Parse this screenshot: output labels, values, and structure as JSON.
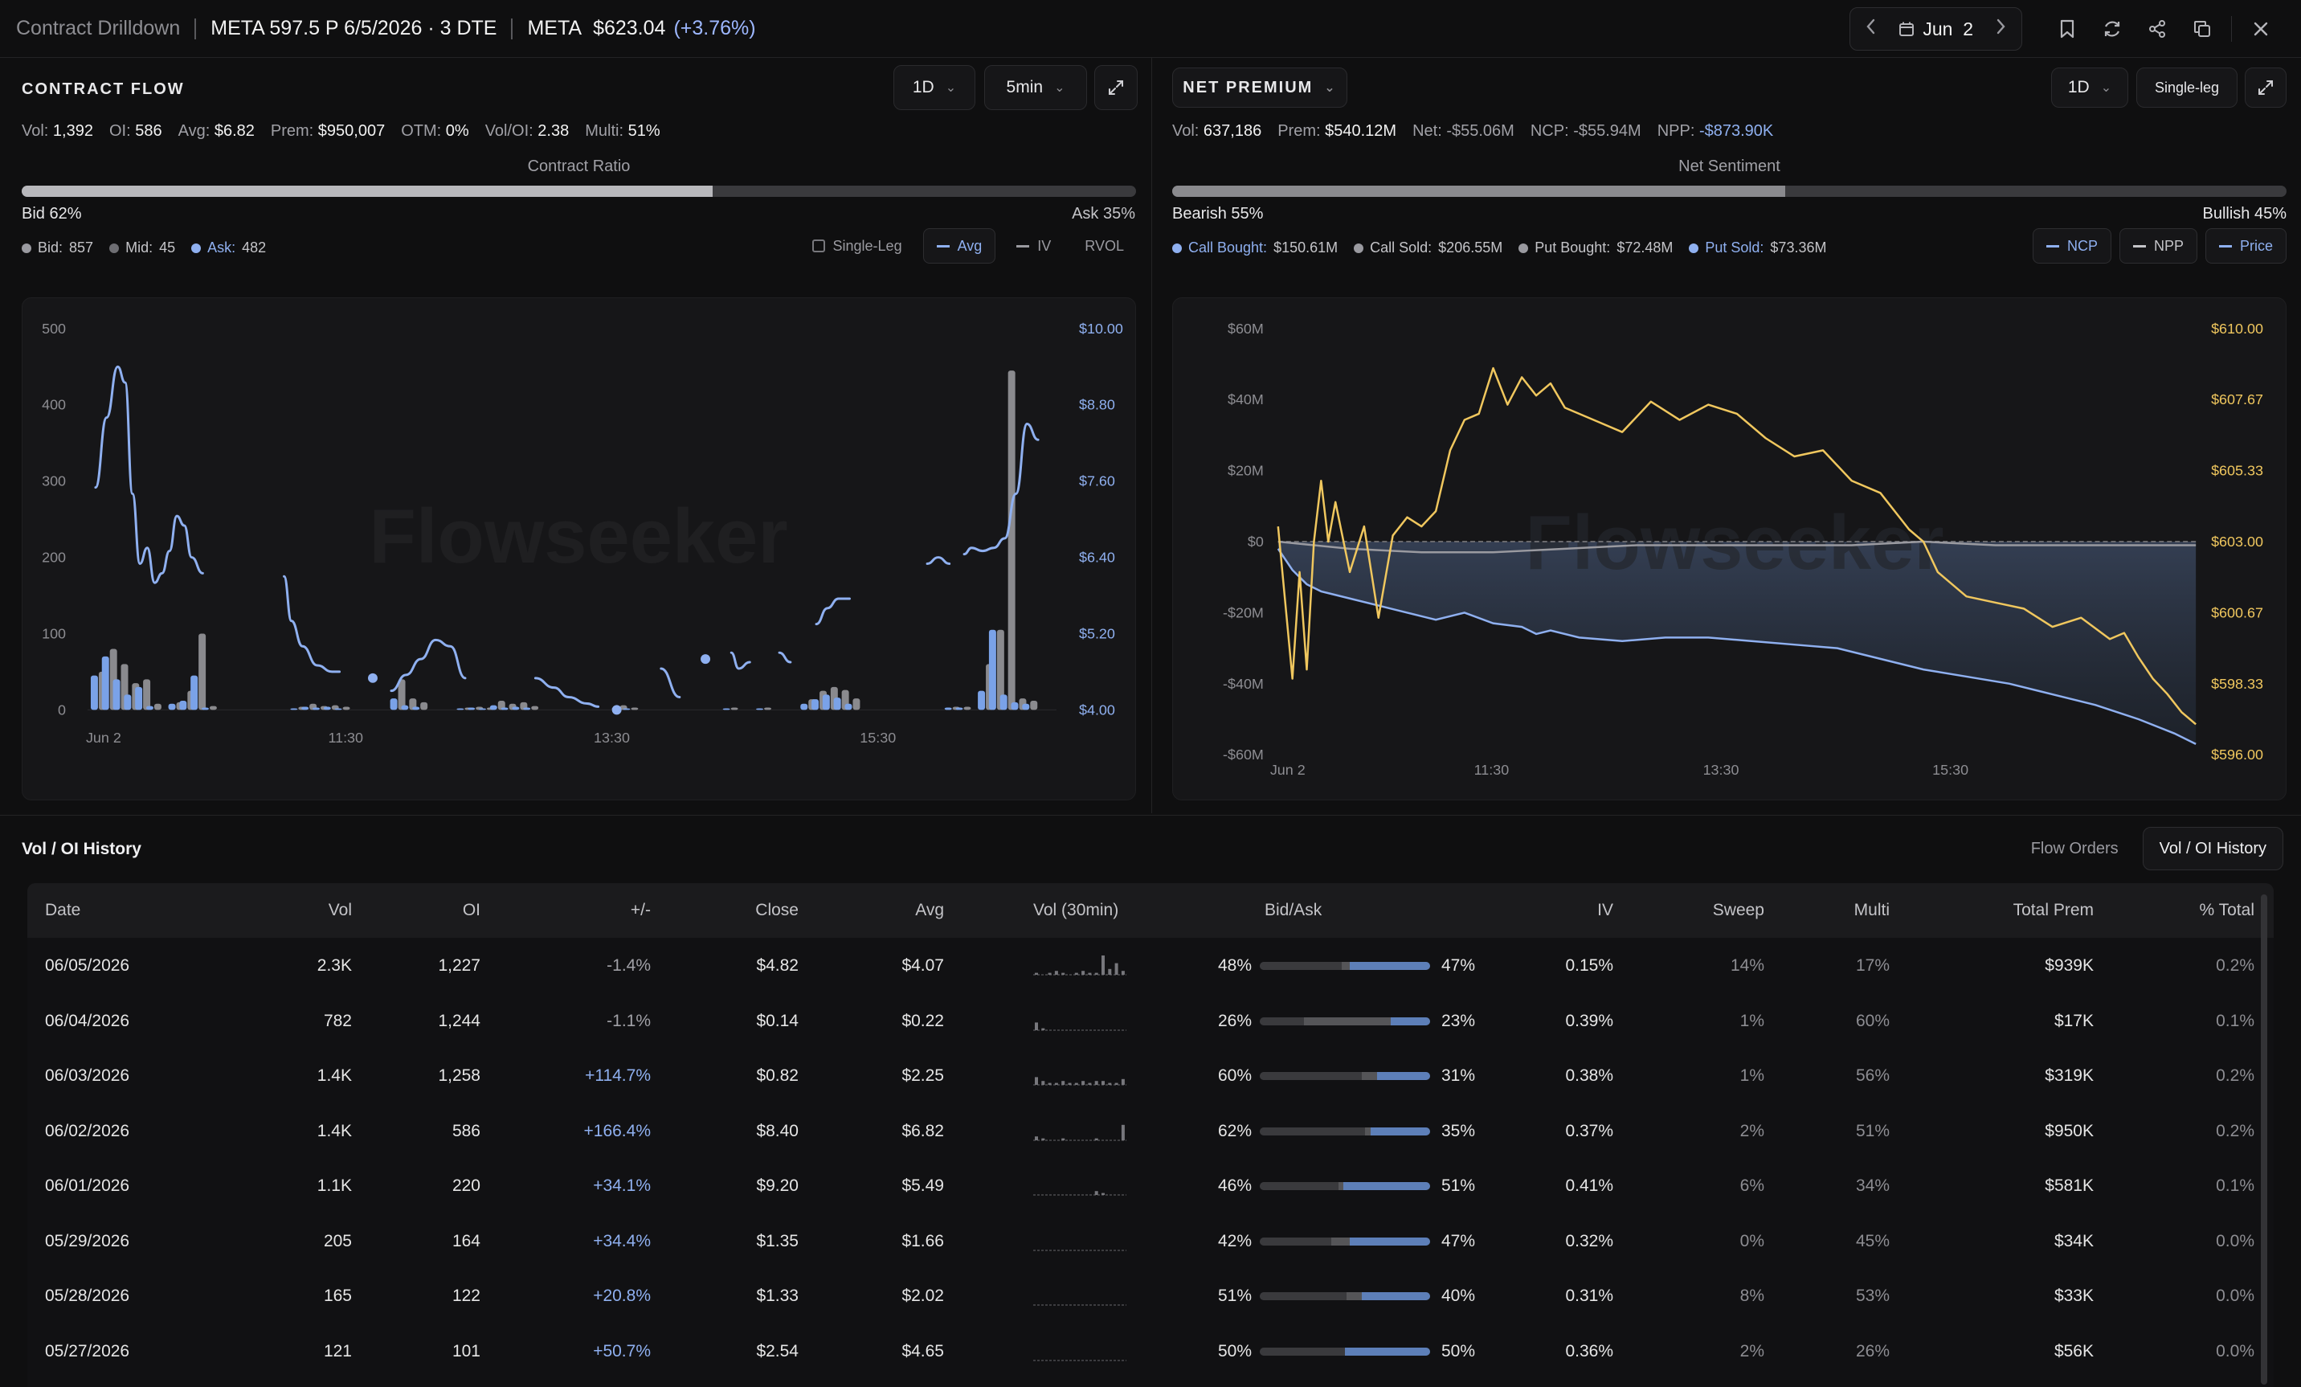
{
  "header": {
    "title": "Contract Drilldown",
    "contract": "META 597.5 P 6/5/2026 · 3 DTE",
    "ticker": "META",
    "price": "$623.04",
    "change": "(+3.76%)",
    "date": "Jun  2"
  },
  "flow": {
    "title": "CONTRACT FLOW",
    "range": "1D",
    "interval": "5min",
    "stats": [
      {
        "label": "Vol:",
        "value": "1,392"
      },
      {
        "label": "OI:",
        "value": "586"
      },
      {
        "label": "Avg:",
        "value": "$6.82"
      },
      {
        "label": "Prem:",
        "value": "$950,007"
      },
      {
        "label": "OTM:",
        "value": "0%"
      },
      {
        "label": "Vol/OI:",
        "value": "2.38"
      },
      {
        "label": "Multi:",
        "value": "51%"
      }
    ],
    "ratio_label": "Contract Ratio",
    "bid_pct": 62,
    "bid_text": "Bid 62%",
    "ask_text": "Ask 35%",
    "legend": [
      {
        "label": "Bid:",
        "value": "857",
        "color": "#9a9aa0"
      },
      {
        "label": "Mid:",
        "value": "45",
        "color": "#6e6e73"
      },
      {
        "label": "Ask:",
        "value": "482",
        "color": "#8fb0f0"
      }
    ],
    "toggles": {
      "single_leg": "Single-Leg",
      "avg": "Avg",
      "iv": "IV",
      "rvol": "RVOL"
    }
  },
  "premium": {
    "title": "NET PREMIUM",
    "range": "1D",
    "mode": "Single-leg",
    "stats": [
      {
        "label": "Vol:",
        "value": "637,186"
      },
      {
        "label": "Prem:",
        "value": "$540.12M"
      },
      {
        "label": "Net:",
        "value": "-$55.06M"
      },
      {
        "label": "NCP:",
        "value": "-$55.94M"
      },
      {
        "label": "NPP:",
        "value": "-$873.90K"
      }
    ],
    "sentiment_label": "Net Sentiment",
    "bearish_pct": 55,
    "bearish_text": "Bearish 55%",
    "bullish_text": "Bullish 45%",
    "legend": [
      {
        "label": "Call Bought:",
        "value": "$150.61M",
        "color": "#8fb0f0"
      },
      {
        "label": "Call Sold:",
        "value": "$206.55M",
        "color": "#9a9aa0"
      },
      {
        "label": "Put Bought:",
        "value": "$72.48M",
        "color": "#9a9aa0"
      },
      {
        "label": "Put Sold:",
        "value": "$73.36M",
        "color": "#8fb0f0"
      }
    ],
    "toggles": {
      "ncp": "NCP",
      "npp": "NPP",
      "price": "Price"
    }
  },
  "chart_data": [
    {
      "type": "bar",
      "watermark": "Flowseeker",
      "x_ticks": [
        "Jun 2",
        "11:30",
        "13:30",
        "15:30"
      ],
      "y_left_ticks": [
        "500",
        "400",
        "300",
        "200",
        "100",
        "0"
      ],
      "y_right_ticks": [
        "$10.00",
        "$8.80",
        "$7.60",
        "$6.40",
        "$5.20",
        "$4.00"
      ],
      "ylim": [
        0,
        500
      ],
      "y2lim": [
        4.0,
        10.0
      ],
      "bars": [
        {
          "t": 0.0,
          "ask": 45,
          "bid": 50
        },
        {
          "t": 1.5,
          "ask": 70,
          "bid": 80
        },
        {
          "t": 3.0,
          "ask": 40,
          "bid": 60
        },
        {
          "t": 4.5,
          "ask": 20,
          "bid": 35
        },
        {
          "t": 6.0,
          "ask": 30,
          "bid": 40
        },
        {
          "t": 7.5,
          "ask": 5,
          "bid": 8
        },
        {
          "t": 10.5,
          "ask": 8,
          "bid": 10
        },
        {
          "t": 12.0,
          "ask": 12,
          "bid": 25
        },
        {
          "t": 13.5,
          "ask": 45,
          "bid": 100
        },
        {
          "t": 15.0,
          "ask": 3,
          "bid": 5
        },
        {
          "t": 27.0,
          "ask": 2,
          "bid": 4
        },
        {
          "t": 28.5,
          "ask": 4,
          "bid": 8
        },
        {
          "t": 30.0,
          "ask": 3,
          "bid": 5
        },
        {
          "t": 31.5,
          "ask": 4,
          "bid": 6
        },
        {
          "t": 33.0,
          "ask": 2,
          "bid": 4
        },
        {
          "t": 40.5,
          "ask": 15,
          "bid": 40
        },
        {
          "t": 42.0,
          "ask": 6,
          "bid": 15
        },
        {
          "t": 43.5,
          "ask": 4,
          "bid": 10
        },
        {
          "t": 49.5,
          "ask": 2,
          "bid": 3
        },
        {
          "t": 51.0,
          "ask": 3,
          "bid": 4
        },
        {
          "t": 52.5,
          "ask": 2,
          "bid": 3
        },
        {
          "t": 54.0,
          "ask": 6,
          "bid": 12
        },
        {
          "t": 55.5,
          "ask": 3,
          "bid": 8
        },
        {
          "t": 57.0,
          "ask": 4,
          "bid": 10
        },
        {
          "t": 58.5,
          "ask": 3,
          "bid": 5
        },
        {
          "t": 70.5,
          "ask": 3,
          "bid": 6
        },
        {
          "t": 72.0,
          "ask": 2,
          "bid": 3
        },
        {
          "t": 85.5,
          "ask": 2,
          "bid": 3
        },
        {
          "t": 90.0,
          "ask": 2,
          "bid": 3
        },
        {
          "t": 96.0,
          "ask": 8,
          "bid": 14
        },
        {
          "t": 97.5,
          "ask": 14,
          "bid": 25
        },
        {
          "t": 99.0,
          "ask": 20,
          "bid": 30
        },
        {
          "t": 100.5,
          "ask": 16,
          "bid": 26
        },
        {
          "t": 102.0,
          "ask": 8,
          "bid": 15
        },
        {
          "t": 115.5,
          "ask": 3,
          "bid": 4
        },
        {
          "t": 117.0,
          "ask": 3,
          "bid": 4
        },
        {
          "t": 120.0,
          "ask": 25,
          "bid": 60
        },
        {
          "t": 121.5,
          "ask": 105,
          "bid": 105
        },
        {
          "t": 123.0,
          "ask": 20,
          "bid": 445
        },
        {
          "t": 124.5,
          "ask": 10,
          "bid": 15
        },
        {
          "t": 126.0,
          "ask": 8,
          "bid": 12
        }
      ],
      "avg_segments": [
        [
          [
            0,
            7.5
          ],
          [
            1.5,
            8.6
          ],
          [
            3.0,
            9.4
          ],
          [
            4.0,
            9.15
          ],
          [
            5.0,
            7.4
          ],
          [
            6.0,
            6.3
          ],
          [
            7.0,
            6.55
          ],
          [
            8.0,
            6.0
          ],
          [
            9.0,
            6.15
          ],
          [
            10.0,
            6.5
          ],
          [
            11.0,
            7.05
          ],
          [
            12.0,
            6.9
          ],
          [
            13.0,
            6.4
          ],
          [
            14.5,
            6.15
          ]
        ],
        [
          [
            25.5,
            6.1
          ],
          [
            26.5,
            5.4
          ],
          [
            28.0,
            5.0
          ],
          [
            30.0,
            4.7
          ],
          [
            32.0,
            4.6
          ],
          [
            33.0,
            4.6
          ]
        ],
        [
          [
            37.5,
            4.5
          ]
        ],
        [
          [
            40.0,
            4.3
          ],
          [
            42.0,
            4.55
          ],
          [
            44.0,
            4.8
          ],
          [
            46.0,
            5.1
          ],
          [
            48.0,
            5.0
          ],
          [
            50.0,
            4.5
          ]
        ],
        [
          [
            59.5,
            4.5
          ],
          [
            62.0,
            4.35
          ],
          [
            64.0,
            4.2
          ],
          [
            66.5,
            4.1
          ],
          [
            68.0,
            4.05
          ]
        ],
        [
          [
            70.5,
            4.0
          ]
        ],
        [
          [
            76.5,
            4.65
          ],
          [
            79.0,
            4.2
          ]
        ],
        [
          [
            82.5,
            4.8
          ]
        ],
        [
          [
            86.0,
            4.9
          ],
          [
            87.0,
            4.65
          ],
          [
            88.5,
            4.75
          ]
        ],
        [
          [
            92.5,
            4.9
          ],
          [
            94.0,
            4.75
          ]
        ],
        [
          [
            97.5,
            5.35
          ],
          [
            99.0,
            5.6
          ],
          [
            100.5,
            5.75
          ],
          [
            102.0,
            5.75
          ]
        ],
        [
          [
            112.5,
            6.3
          ],
          [
            114.0,
            6.4
          ],
          [
            115.5,
            6.3
          ]
        ],
        [
          [
            117.5,
            6.45
          ],
          [
            118.5,
            6.55
          ],
          [
            120.0,
            6.5
          ],
          [
            121.5,
            6.55
          ],
          [
            123.0,
            6.7
          ],
          [
            124.5,
            7.4
          ],
          [
            126.0,
            8.5
          ],
          [
            127.5,
            8.25
          ]
        ]
      ]
    },
    {
      "type": "line",
      "watermark": "Flowseeker",
      "x_ticks": [
        "Jun 2",
        "11:30",
        "13:30",
        "15:30"
      ],
      "y_left_ticks": [
        "$60M",
        "$40M",
        "$20M",
        "$0",
        "-$20M",
        "-$40M",
        "-$60M"
      ],
      "y_right_ticks": [
        "$610.00",
        "$607.67",
        "$605.33",
        "$603.00",
        "$600.67",
        "$598.33",
        "$596.00"
      ],
      "ylim": [
        -60,
        60
      ],
      "y2lim": [
        596.0,
        610.0
      ],
      "series": [
        {
          "name": "NCP",
          "color": "#8fb0f0",
          "x": [
            0,
            2,
            4,
            6,
            10,
            14,
            18,
            22,
            26,
            30,
            34,
            36,
            38,
            42,
            48,
            54,
            60,
            66,
            72,
            78,
            84,
            90,
            96,
            102,
            108,
            114,
            120,
            125,
            128
          ],
          "y": [
            -2,
            -8,
            -12,
            -14,
            -16,
            -18,
            -20,
            -22,
            -20,
            -23,
            -24,
            -26,
            -25,
            -27,
            -28,
            -27,
            -27,
            -28,
            -29,
            -30,
            -33,
            -36,
            -38,
            -40,
            -43,
            -46,
            -50,
            -54,
            -57
          ]
        },
        {
          "name": "NPP",
          "color": "#9a9aa0",
          "x": [
            0,
            10,
            20,
            30,
            40,
            50,
            60,
            70,
            80,
            90,
            100,
            110,
            120,
            128
          ],
          "y": [
            0,
            -2,
            -3,
            -3,
            -2,
            -1,
            -1,
            -1,
            -1,
            0,
            -1,
            -1,
            -1,
            -1
          ]
        },
        {
          "name": "Price",
          "color": "#f0c75e",
          "x": [
            0,
            1,
            2,
            3,
            4,
            5,
            6,
            7,
            8,
            10,
            12,
            14,
            16,
            18,
            20,
            22,
            24,
            26,
            28,
            30,
            32,
            34,
            36,
            38,
            40,
            44,
            48,
            52,
            56,
            60,
            64,
            68,
            72,
            76,
            80,
            84,
            86,
            88,
            90,
            92,
            96,
            100,
            104,
            108,
            112,
            116,
            118,
            120,
            122,
            124,
            126,
            128
          ],
          "y": [
            603.5,
            601.0,
            598.5,
            602.0,
            598.8,
            603.0,
            605.0,
            603.0,
            604.3,
            602.0,
            603.5,
            600.5,
            603.2,
            603.8,
            603.5,
            604.0,
            606.0,
            607.0,
            607.2,
            608.7,
            607.5,
            608.4,
            607.8,
            608.2,
            607.4,
            607.0,
            606.6,
            607.6,
            607.0,
            607.5,
            607.2,
            606.4,
            605.8,
            606.0,
            605.0,
            604.6,
            604.0,
            603.4,
            603.0,
            602.0,
            601.2,
            601.0,
            600.8,
            600.2,
            600.5,
            599.8,
            600.0,
            599.2,
            598.5,
            598.0,
            597.4,
            597.0
          ]
        }
      ]
    }
  ],
  "history": {
    "title": "Vol / OI History",
    "tabs": [
      "Flow Orders",
      "Vol / OI History"
    ],
    "columns": [
      "Date",
      "Vol",
      "OI",
      "+/-",
      "Close",
      "Avg",
      "Vol (30min)",
      "Bid/Ask",
      "IV",
      "Sweep",
      "Multi",
      "Total Prem",
      "% Total"
    ],
    "rows": [
      {
        "date": "06/05/2026",
        "vol": "2.3K",
        "oi": "1,227",
        "chg": "-1.4%",
        "close": "$4.82",
        "avg": "$4.07",
        "spark": [
          1,
          0,
          1,
          2,
          1,
          0,
          1,
          2,
          1,
          1,
          10,
          3,
          6,
          2
        ],
        "bid": "48%",
        "ask": "47%",
        "bidf": 0.48,
        "askf": 0.47,
        "iv": "0.15%",
        "sweep": "14%",
        "multi": "17%",
        "prem": "$939K",
        "pct": "0.2%"
      },
      {
        "date": "06/04/2026",
        "vol": "782",
        "oi": "1,244",
        "chg": "-1.1%",
        "close": "$0.14",
        "avg": "$0.22",
        "spark": [
          4,
          1,
          0,
          0,
          0,
          0,
          0,
          0,
          0,
          0,
          0,
          0,
          0,
          0
        ],
        "bid": "26%",
        "ask": "23%",
        "bidf": 0.26,
        "askf": 0.23,
        "iv": "0.39%",
        "sweep": "1%",
        "multi": "60%",
        "prem": "$17K",
        "pct": "0.1%"
      },
      {
        "date": "06/03/2026",
        "vol": "1.4K",
        "oi": "1,258",
        "chg": "+114.7%",
        "close": "$0.82",
        "avg": "$2.25",
        "spark": [
          4,
          2,
          1,
          1,
          2,
          1,
          1,
          2,
          1,
          2,
          2,
          1,
          1,
          3
        ],
        "bid": "60%",
        "ask": "31%",
        "bidf": 0.6,
        "askf": 0.31,
        "iv": "0.38%",
        "sweep": "1%",
        "multi": "56%",
        "prem": "$319K",
        "pct": "0.2%"
      },
      {
        "date": "06/02/2026",
        "vol": "1.4K",
        "oi": "586",
        "chg": "+166.4%",
        "close": "$8.40",
        "avg": "$6.82",
        "spark": [
          2,
          1,
          0,
          0,
          1,
          0,
          0,
          0,
          0,
          1,
          0,
          0,
          0,
          8
        ],
        "bid": "62%",
        "ask": "35%",
        "bidf": 0.62,
        "askf": 0.35,
        "iv": "0.37%",
        "sweep": "2%",
        "multi": "51%",
        "prem": "$950K",
        "pct": "0.2%"
      },
      {
        "date": "06/01/2026",
        "vol": "1.1K",
        "oi": "220",
        "chg": "+34.1%",
        "close": "$9.20",
        "avg": "$5.49",
        "spark": [
          0,
          0,
          0,
          0,
          0,
          0,
          0,
          0,
          0,
          2,
          1,
          0,
          0,
          0
        ],
        "bid": "46%",
        "ask": "51%",
        "bidf": 0.46,
        "askf": 0.51,
        "iv": "0.41%",
        "sweep": "6%",
        "multi": "34%",
        "prem": "$581K",
        "pct": "0.1%"
      },
      {
        "date": "05/29/2026",
        "vol": "205",
        "oi": "164",
        "chg": "+34.4%",
        "close": "$1.35",
        "avg": "$1.66",
        "spark": [
          0,
          0,
          0,
          0,
          0,
          0,
          0,
          0,
          0,
          0,
          0,
          0,
          0,
          0
        ],
        "bid": "42%",
        "ask": "47%",
        "bidf": 0.42,
        "askf": 0.47,
        "iv": "0.32%",
        "sweep": "0%",
        "multi": "45%",
        "prem": "$34K",
        "pct": "0.0%"
      },
      {
        "date": "05/28/2026",
        "vol": "165",
        "oi": "122",
        "chg": "+20.8%",
        "close": "$1.33",
        "avg": "$2.02",
        "spark": [
          0,
          0,
          0,
          0,
          0,
          0,
          0,
          0,
          0,
          0,
          0,
          0,
          0,
          0
        ],
        "bid": "51%",
        "ask": "40%",
        "bidf": 0.51,
        "askf": 0.4,
        "iv": "0.31%",
        "sweep": "8%",
        "multi": "53%",
        "prem": "$33K",
        "pct": "0.0%"
      },
      {
        "date": "05/27/2026",
        "vol": "121",
        "oi": "101",
        "chg": "+50.7%",
        "close": "$2.54",
        "avg": "$4.65",
        "spark": [
          0,
          0,
          0,
          0,
          0,
          0,
          0,
          0,
          0,
          0,
          0,
          0,
          0,
          0
        ],
        "bid": "50%",
        "ask": "50%",
        "bidf": 0.5,
        "askf": 0.5,
        "iv": "0.36%",
        "sweep": "2%",
        "multi": "26%",
        "prem": "$56K",
        "pct": "0.0%"
      }
    ]
  }
}
